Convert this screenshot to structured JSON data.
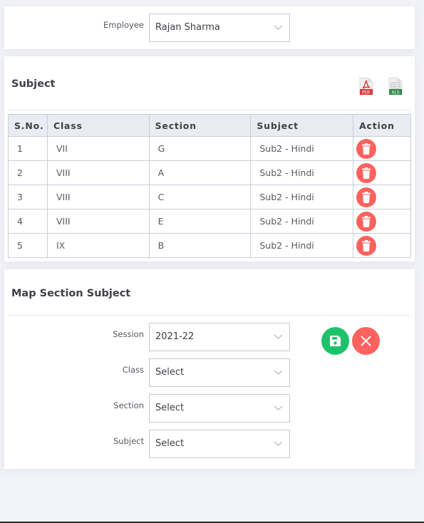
{
  "employee": {
    "label": "Employee",
    "value": "Rajan Sharma"
  },
  "subject_card": {
    "title": "Subject",
    "export_icons": [
      {
        "name": "pdf-export-icon",
        "label": "PDF",
        "color": "#d9383d"
      },
      {
        "name": "xls-export-icon",
        "label": "XLS",
        "color": "#2e8b47"
      }
    ],
    "table": {
      "headers": [
        "S.No.",
        "Class",
        "Section",
        "Subject",
        "Action"
      ],
      "rows": [
        {
          "sno": "1",
          "class": "VII",
          "section": "G",
          "subject": "Sub2 - Hindi"
        },
        {
          "sno": "2",
          "class": "VIII",
          "section": "A",
          "subject": "Sub2 - Hindi"
        },
        {
          "sno": "3",
          "class": "VIII",
          "section": "C",
          "subject": "Sub2 - Hindi"
        },
        {
          "sno": "4",
          "class": "VIII",
          "section": "E",
          "subject": "Sub2 - Hindi"
        },
        {
          "sno": "5",
          "class": "IX",
          "section": "B",
          "subject": "Sub2 - Hindi"
        }
      ]
    }
  },
  "map_card": {
    "title": "Map Section Subject",
    "fields": {
      "session": {
        "label": "Session",
        "value": "2021-22"
      },
      "class": {
        "label": "Class",
        "value": "Select"
      },
      "section": {
        "label": "Section",
        "value": "Select"
      },
      "subject": {
        "label": "Subject",
        "value": "Select"
      }
    },
    "buttons": {
      "save": {
        "icon": "save-icon",
        "color": "#1fc26c"
      },
      "cancel": {
        "icon": "close-icon",
        "color": "#fd625e"
      }
    }
  },
  "colors": {
    "danger": "#fd625e",
    "success": "#1fc26c",
    "background": "#f2f3f8",
    "table_header": "#e9ecf3"
  }
}
